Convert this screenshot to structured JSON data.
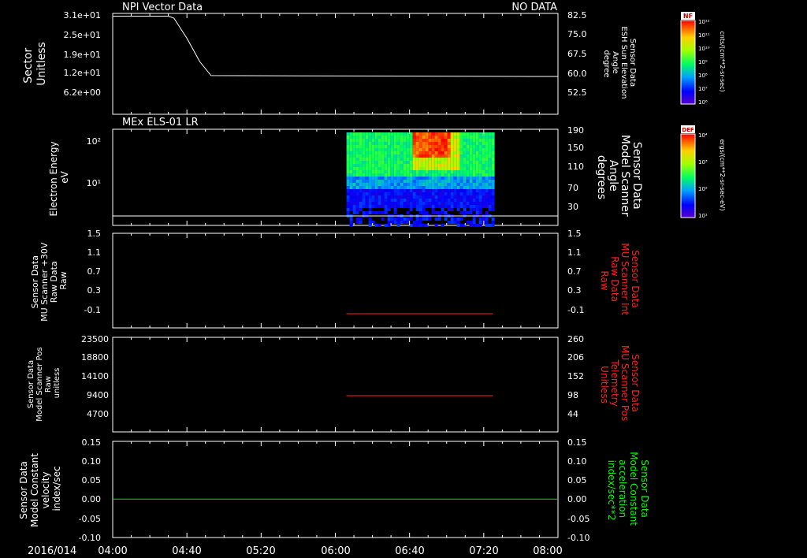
{
  "time_axis": {
    "date_label": "2016/014",
    "ticks": [
      "04:00",
      "04:40",
      "05:20",
      "06:00",
      "06:40",
      "07:20",
      "08:00"
    ],
    "range": [
      "04:00",
      "08:00"
    ]
  },
  "colors": {
    "frame": "#ffffff",
    "trace_white": "#ffffff",
    "trace_red": "#ff2020",
    "trace_green": "#00e000",
    "label_red": "#ff2020",
    "label_green": "#00ff00"
  },
  "panels": [
    {
      "title_left": "NPI Vector Data",
      "title_right": "NO DATA",
      "ylabel_left": [
        "Sector",
        "Unitless"
      ],
      "yticks_left": [
        "3.1e+01",
        "2.5e+01",
        "1.9e+01",
        "1.2e+01",
        "6.2e+00"
      ],
      "ylabel_right": [
        "Sensor Data",
        "ESH Sun Elevation",
        "Angle",
        "degree"
      ],
      "yticks_right": [
        "82.5",
        "75.0",
        "67.5",
        "60.0",
        "52.5"
      ],
      "colorbar": {
        "label": "NF",
        "ticks": [
          "10¹²",
          "10¹¹",
          "10¹⁰",
          "10⁹",
          "10⁸",
          "10⁷",
          "10⁶"
        ],
        "unit": "cnts/(cm**2-sr-sec)"
      }
    },
    {
      "title_left": "MEx ELS-01 LR",
      "ylabel_left": [
        "Electron Energy",
        "eV"
      ],
      "yticks_left": [
        "10²",
        "10¹"
      ],
      "ylabel_right": [
        "Sensor Data",
        "Model Scanner",
        "Angle",
        "degrees"
      ],
      "yticks_right": [
        "190",
        "150",
        "110",
        "70",
        "30"
      ],
      "colorbar": {
        "label": "DEF",
        "ticks": [
          "10⁴",
          "10³",
          "10²",
          "10¹"
        ],
        "unit": "ergs/(cm**2-sr-sec-eV)"
      }
    },
    {
      "ylabel_left": [
        "Sensor Data",
        "MU Scanner +30V",
        "Raw Data",
        "Raw"
      ],
      "yticks_left": [
        "1.5",
        "1.1",
        "0.7",
        "0.3",
        "-0.1"
      ],
      "ylabel_right": [
        "Sensor Data",
        "MU Scanner Int",
        "Raw Data",
        "Raw"
      ],
      "yticks_right": [
        "1.5",
        "1.1",
        "0.7",
        "0.3",
        "-0.1"
      ]
    },
    {
      "ylabel_left": [
        "Sensor Data",
        "Model Scanner Pos",
        "Raw",
        "unitless"
      ],
      "yticks_left": [
        "23500",
        "18800",
        "14100",
        "9400",
        "4700"
      ],
      "ylabel_right": [
        "Sensor Data",
        "MU Scanner Pos",
        "Telemetry",
        "Unitless"
      ],
      "yticks_right": [
        "260",
        "206",
        "152",
        "98",
        "44"
      ]
    },
    {
      "ylabel_left": [
        "Sensor Data",
        "Model Constant",
        "velocity",
        "index/sec"
      ],
      "yticks_left": [
        "0.15",
        "0.10",
        "0.05",
        "0.00",
        "-0.05",
        "-0.10"
      ],
      "ylabel_right": [
        "Sensor Data",
        "Model Constant",
        "acceleration",
        "index/sec**2"
      ],
      "yticks_right": [
        "0.15",
        "0.10",
        "0.05",
        "0.00",
        "-0.05",
        "-0.10"
      ]
    }
  ],
  "chart_data": [
    {
      "type": "line",
      "title": "NPI Vector Data",
      "series": [
        {
          "values": [
            {
              "t": "04:00",
              "v": 81.5
            },
            {
              "t": "04:30",
              "v": 81.5
            },
            {
              "t": "04:33",
              "v": 80.8
            },
            {
              "t": "04:40",
              "v": 73.5
            },
            {
              "t": "04:47",
              "v": 65.0
            },
            {
              "t": "04:53",
              "v": 60.0
            },
            {
              "t": "07:46",
              "v": 59.7
            },
            {
              "t": "08:00",
              "v": 59.7
            }
          ]
        }
      ],
      "ylim_right": [
        46,
        82.5
      ]
    },
    {
      "type": "heatmap",
      "title": "MEx ELS-01 LR",
      "x_range": [
        "06:06",
        "07:25"
      ],
      "y_scale": "log",
      "baseline_angle_deg": 20
    },
    {
      "type": "line",
      "series": [
        {
          "x": [
            "06:06",
            "07:25"
          ],
          "values": [
            -0.2,
            -0.2
          ]
        }
      ],
      "ylim": [
        -0.5,
        1.5
      ]
    },
    {
      "type": "line",
      "series": [
        {
          "x": [
            "06:06",
            "07:25"
          ],
          "values": [
            9000,
            9000
          ]
        }
      ],
      "ylim": [
        0,
        23500
      ]
    },
    {
      "type": "line",
      "series": [
        {
          "x": [
            "04:00",
            "08:00"
          ],
          "values": [
            0.0,
            0.0
          ]
        }
      ],
      "ylim": [
        -0.1,
        0.15
      ]
    }
  ]
}
